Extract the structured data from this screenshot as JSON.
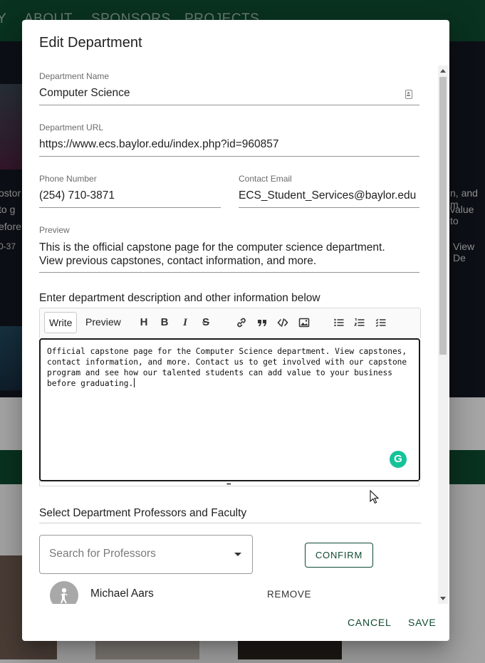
{
  "background": {
    "nav": [
      "Y",
      "ABOUT",
      "SPONSORS",
      "PROJECTS"
    ],
    "side_left": [
      "ostor",
      "to g",
      "efore",
      "0-37"
    ],
    "side_right": [
      "n, and m",
      "value to",
      "View De"
    ]
  },
  "dialog": {
    "title": "Edit Department",
    "department_name": {
      "label": "Department Name",
      "value": "Computer Science"
    },
    "department_url": {
      "label": "Department URL",
      "value": "https://www.ecs.baylor.edu/index.php?id=960857"
    },
    "phone": {
      "label": "Phone Number",
      "value": "(254) 710-3871"
    },
    "email": {
      "label": "Contact Email",
      "value": "ECS_Student_Services@baylor.edu"
    },
    "preview": {
      "label": "Preview",
      "value": "This is the official capstone page for the computer science department. View previous capstones, contact information, and more."
    },
    "description_label": "Enter department description and other information below",
    "editor": {
      "tab_write": "Write",
      "tab_preview": "Preview",
      "text": "Official capstone page for the Computer Science department. View capstones, contact information, and more. Contact us to get involved with our capstone program and see how our talented students can add value to your business before graduating.",
      "tools": [
        "header-icon",
        "bold-icon",
        "italic-icon",
        "strikethrough-icon",
        "link-icon",
        "quote-icon",
        "code-icon",
        "image-icon",
        "unordered-list-icon",
        "ordered-list-icon",
        "checked-list-icon"
      ]
    },
    "professors": {
      "label": "Select Department Professors and Faculty",
      "search_placeholder": "Search for Professors",
      "confirm_label": "CONFIRM",
      "list": [
        {
          "name": "Michael Aars",
          "remove_label": "REMOVE"
        }
      ]
    },
    "actions": {
      "cancel": "CANCEL",
      "save": "SAVE"
    }
  },
  "colors": {
    "brand_green": "#0f4a30",
    "grammarly": "#15c39a"
  }
}
